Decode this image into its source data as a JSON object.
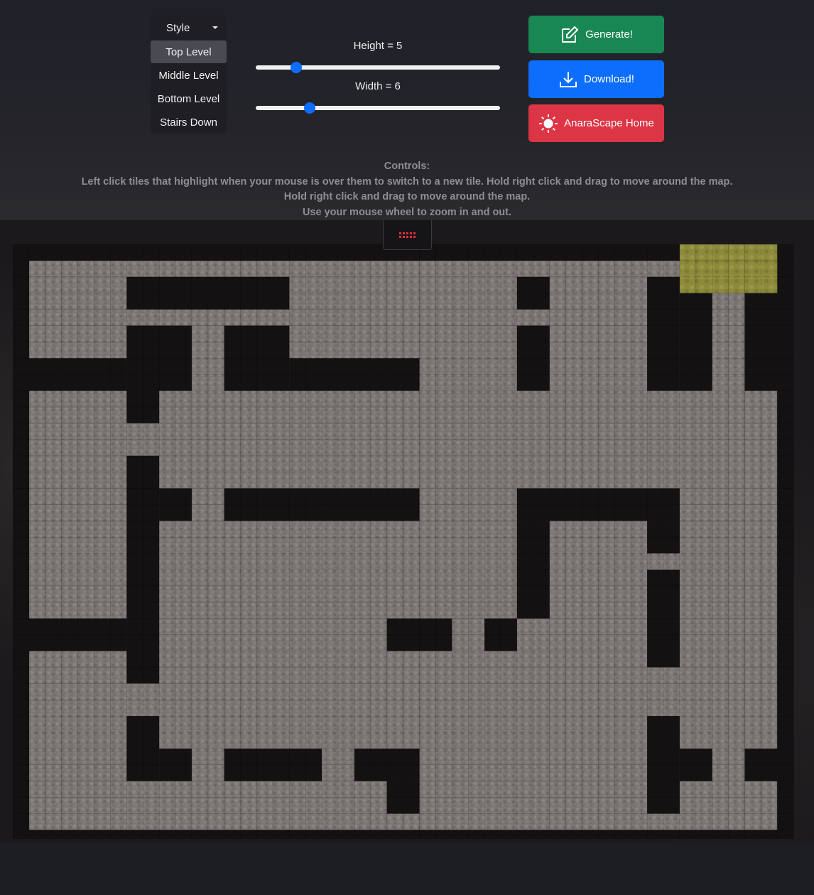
{
  "style_menu": {
    "toggle_label": "Style",
    "items": [
      {
        "label": "Top Level",
        "active": true
      },
      {
        "label": "Middle Level",
        "active": false
      },
      {
        "label": "Bottom Level",
        "active": false
      },
      {
        "label": "Stairs Down",
        "active": false
      }
    ]
  },
  "sliders": {
    "height": {
      "label": "Height = 5",
      "value": 5,
      "min": 2,
      "max": 20
    },
    "width": {
      "label": "Width = 6",
      "value": 6,
      "min": 2,
      "max": 20
    }
  },
  "buttons": {
    "generate": {
      "label": "Generate!",
      "icon": "edit-icon",
      "color": "#198754"
    },
    "download": {
      "label": "Download!",
      "icon": "download-icon",
      "color": "#0d6efd"
    },
    "home": {
      "label": "AnaraScape Home",
      "icon": "sun-icon",
      "color": "#dc3545"
    }
  },
  "controls": {
    "title": "Controls:",
    "lines": [
      "Left click tiles that highlight when your mouse is over them to switch to a new tile. Hold right click and drag to move around the map.",
      "Hold right click and drag to move around the map.",
      "Use your mouse wheel to zoom in and out."
    ]
  },
  "map": {
    "handle_icon": "drag-handle-icon",
    "colors": {
      "floor": "#797372",
      "wall": "#141112",
      "stairs": "#8d8a3c",
      "accent": "#e0313f"
    },
    "rows": [
      "WWWWWWWWWWWWWWWWWWWWWWWWWWWWWWWWWWWWWWWWWWWWWWWWWW",
      "WWWWWWWWWWWWWWWWWWWWWWWWWWWWWWWWWWWWWWWWWWSSSSSSWW",
      "WFFFFFFWWWWWWWWWWWFFFFFFFFFFFFFFWWFFFFFFWWSSSSSSWW",
      "WFFFFFFWWWWWWWWWWWFFFFFFFFFFFFFFWWFFFFFFWWSSSSSSWW",
      "WFFFFFFWWWWWWWWWWWFFFFFFFFFFFFFFWWFFFFFFWWSSSSSSWW",
      "WFFFFFFWWWWWWWWWWWFFFFFFFFFFFFFFWWFFFFFFWWWWWFFWWW",
      "WFFFFFFFFFFFFFFFFFFFFFFFFFFFFFFFFFFFFFFFWWWWWFFWWW",
      "WFFFFFFWWWWFFWWWWFFFFFFFFFFFFFFFWWFFFFFFWWWWWFFWWW",
      "WFFFFFFWWWWFFWWWWFFFFFFFFFFFFFFFWWFFFFFFWWWWWFFWWW",
      "WWWWWWWWWWWFFWWWWWWWWWWWWWFFFFFFWWFFFFFFWWWWWFFWWW",
      "WWWWWWWWWWWFFWWWWWWWWWWWWWFFFFFFWWFFFFFFWWWWWFFWWW",
      "WFFFFFFFFFFFFFFFFFFFFFFFFFFFFFFFFFFFFFFFFFFFFFFFWW",
      "WFFFFFFWWFFFFFFFFFFFFFFFFFFFFFFFFFFFFFFFFFFFFFFFWW",
      "WFFFFFFWWFFFFFFFFFFFFFFFFFFFFFFFFFFFFFFFFFFFFFFFWW",
      "WFFFFFFFFFFFFFFFFFFFFFFFFFFFFFFFFFFFFFFFFFFFFFFFWW",
      "WFFFFFFFFFFFFFFFFFFFFFFFFFFFFFFFFFFFFFFFFFFFFFFFWW",
      "WFFFFFFFFFFFFFFFFFFFFFFFFFFFFFFFFFFFFFFFFFFFFFFFWW",
      "WFFFFFFFFFFFFFFFFFFFFFFFFFFFFFFFFFFFFFFFFFFFFFFFWW",
      "WFFFFFFWWFFFFFFFFFFFFFFFFFFFFFFFFFFFFFFFFFFFFFFFWW",
      "WFFFFFFWWFFFFFFFFFFFFFFFFFFFFFFFFFFFFFFFFFFFFFFFWW",
      "WFFFFFFWWFFFFFFFFFFFFFFFFFFFFFFFFFFFFFFFFFFFFFFFWW",
      "WFFFFFFWWFFFFFFFFFFFFFFFFFFFFFFFFFFFFFFFFFFFFFFFWW",
      "WFFFFFFWWFFFFFFFFFFFFFFFFFFFFFFFFFFFFFFFFFFFFFFFWW",
      "WFFFFFFWWFFFFFFFFFFFFFFFFFFFFFFFFFFFFFFFFFFFFFFFWW",
      "WWWWWWWWWFFFFFFFFFFFFFFFFFFFFFFFFFFFFFFFFFFFFFFFWW",
      "WWWWWWWWWFFFFFFFFFFFFFFFFFFFFFFFFFFFFFFFFFFFFFFFWW",
      "WFFFFFFWWFFFFFFFFFFFFFFFFFFFFFFFFFFFFFFFFFFFFFFFWW",
      "WFFFFFFWWFFFFFFFFFFFFFFFFFFFFFFFFFFFFFFFFFFFFFFFWW",
      "WFFFFFFFFFFFFFFFFFFFFFFFFFFFFFFFFFFFFFFFFFFFFFFFWW",
      "WFFFFFFFFFFFFFFFFFFFFFFFFFFFFFFFFFFFFFFFFFFFFFFFWW",
      "WFFFFFFFFFFFFFFFFFFFFFFFFFFFFFFFFFFFFFFFFFFFFFFFWW",
      "WFFFFFFFFFFFFFFFFFFFFFFFFFFFFFFFFFFFFFFFFFFFFFFFWW",
      "WFFFFFFFFFFFFFFFFFFFFFFFFFFFFFFFFFFFFFFFFFFFFFFFWW",
      "WFFFFFFFFFFFFFFFFFFFFFFFFFFFFFFFFFFFFFFFFFFFFFFFWW",
      "WFFFFFFFFFFFFFFFFFFFFFFFFFFFFFFFFFFFFFFFFFFFFFFFWW",
      "WFFFFFFFFFFFFFFFFFFFFFFFFFFFFFFFFFFFFFFFFFFFFFFFWW",
      "WWWWWWWWWWWWWWWWWWWWWWWWWWWWWWWWWWWWWWWWWWWWWWWWWW"
    ],
    "blocks": [
      {
        "c": 7,
        "r": 2,
        "w": 10,
        "h": 2
      },
      {
        "c": 7,
        "r": 5,
        "w": 4,
        "h": 4
      },
      {
        "c": 13,
        "r": 5,
        "w": 4,
        "h": 4
      },
      {
        "c": 17,
        "r": 7,
        "w": 8,
        "h": 2
      },
      {
        "c": 1,
        "r": 7,
        "w": 6,
        "h": 2
      },
      {
        "c": 7,
        "r": 9,
        "w": 2,
        "h": 2
      },
      {
        "c": 31,
        "r": 2,
        "w": 2,
        "h": 2
      },
      {
        "c": 31,
        "r": 5,
        "w": 2,
        "h": 4
      },
      {
        "c": 39,
        "r": 2,
        "w": 2,
        "h": 7
      },
      {
        "c": 41,
        "r": 3,
        "w": 2,
        "h": 6
      },
      {
        "c": 45,
        "r": 3,
        "w": 2,
        "h": 6
      },
      {
        "c": 7,
        "r": 13,
        "w": 2,
        "h": 14
      },
      {
        "c": 9,
        "r": 15,
        "w": 2,
        "h": 2
      },
      {
        "c": 13,
        "r": 15,
        "w": 12,
        "h": 2
      },
      {
        "c": 31,
        "r": 15,
        "w": 10,
        "h": 2
      },
      {
        "c": 31,
        "r": 17,
        "w": 2,
        "h": 6
      },
      {
        "c": 39,
        "r": 17,
        "w": 2,
        "h": 2
      },
      {
        "c": 39,
        "r": 20,
        "w": 2,
        "h": 6
      },
      {
        "c": 1,
        "r": 23,
        "w": 6,
        "h": 2
      },
      {
        "c": 23,
        "r": 23,
        "w": 4,
        "h": 2
      },
      {
        "c": 29,
        "r": 23,
        "w": 2,
        "h": 2
      },
      {
        "c": 7,
        "r": 29,
        "w": 2,
        "h": 4
      },
      {
        "c": 9,
        "r": 31,
        "w": 2,
        "h": 2
      },
      {
        "c": 13,
        "r": 31,
        "w": 6,
        "h": 2
      },
      {
        "c": 21,
        "r": 31,
        "w": 4,
        "h": 2
      },
      {
        "c": 23,
        "r": 33,
        "w": 2,
        "h": 2
      },
      {
        "c": 39,
        "r": 29,
        "w": 2,
        "h": 6
      },
      {
        "c": 41,
        "r": 31,
        "w": 2,
        "h": 2
      },
      {
        "c": 45,
        "r": 31,
        "w": 2,
        "h": 2
      }
    ]
  }
}
